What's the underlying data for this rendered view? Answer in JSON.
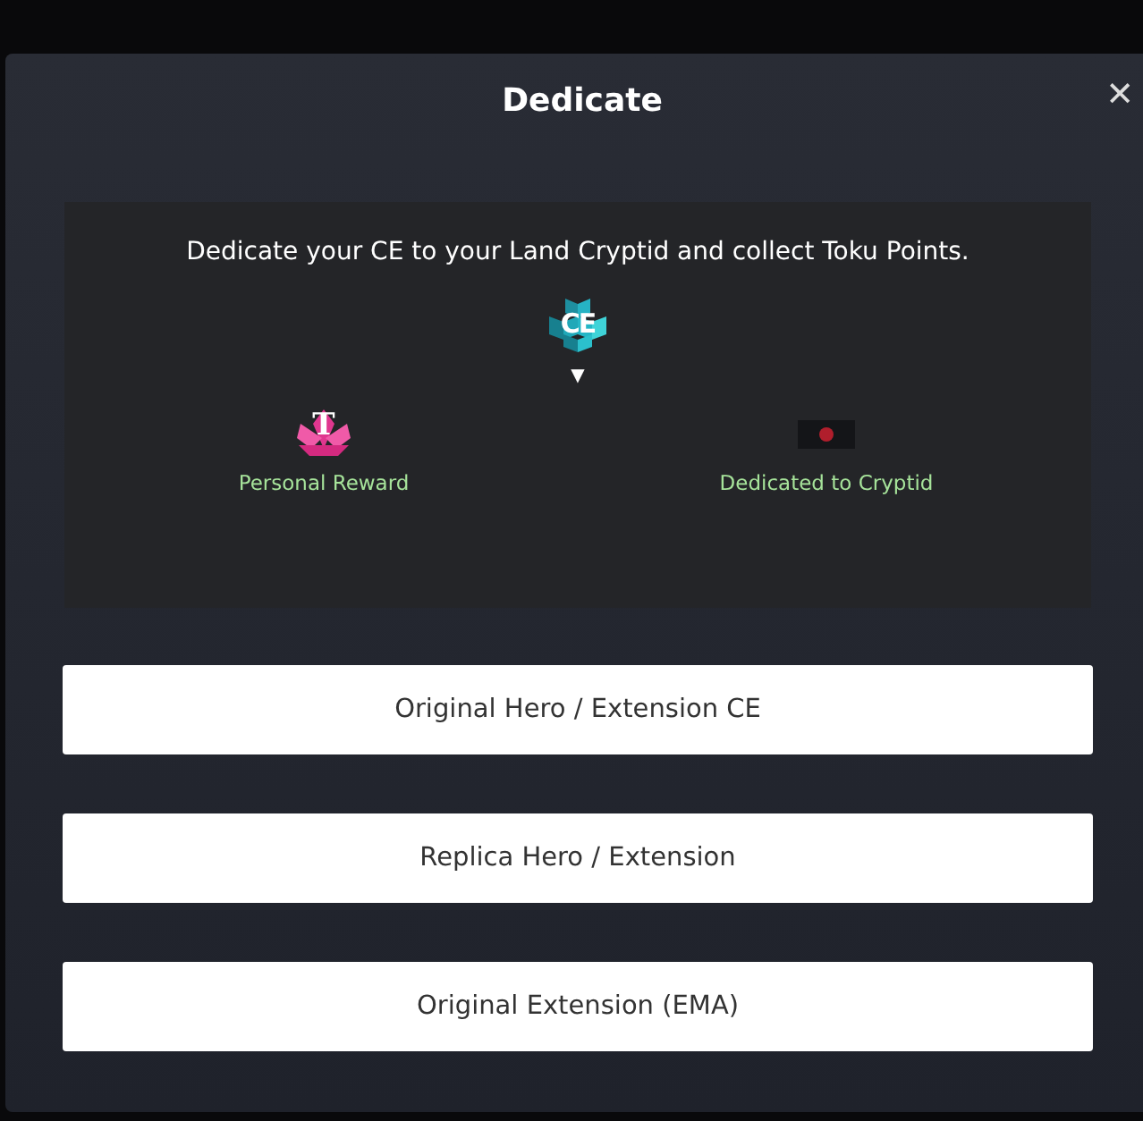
{
  "dialog": {
    "title": "Dedicate",
    "close": "✕"
  },
  "info": {
    "message": "Dedicate your CE to your Land Cryptid and collect Toku Points.",
    "source_icon_text": "CE",
    "flow_arrow": "▼",
    "targets": [
      {
        "kind": "reward",
        "icon_text": "T",
        "label": "Personal Reward"
      },
      {
        "kind": "cryptid",
        "label": "Dedicated to Cryptid"
      }
    ]
  },
  "options": [
    {
      "label": "Original Hero / Extension CE"
    },
    {
      "label": "Replica Hero / Extension"
    },
    {
      "label": "Original Extension (EMA)"
    }
  ]
}
